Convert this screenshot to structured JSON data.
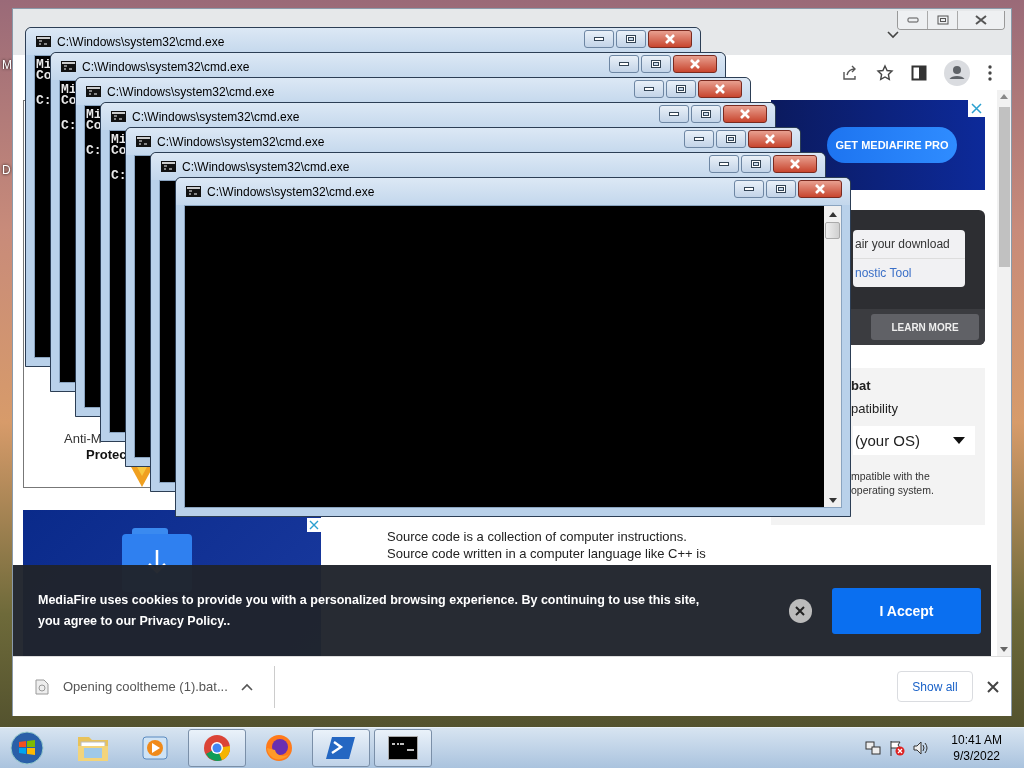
{
  "desktop": {
    "icon_labels": [
      {
        "label": "M"
      },
      {
        "label": "D"
      }
    ]
  },
  "browser": {
    "page": {
      "left_ad": {
        "lines": [
          "Anti-M",
          "Protec"
        ]
      },
      "description": [
        "Source code is a collection of computer instructions.",
        "Source code written in a computer language like C++ is"
      ],
      "top_banner": {
        "button": "GET MEDIAFIRE PRO"
      },
      "repair_card": {
        "line": "air your download",
        "link": "nostic Tool",
        "button": "LEARN MORE"
      },
      "compat_panel": {
        "title": "bat",
        "subtitle": "patibility",
        "select": "(your OS)",
        "note": [
          "mpatible with the",
          "operating system."
        ]
      }
    },
    "cookie_banner": {
      "text": "MediaFire uses cookies to provide you with a personalized browsing experience. By continuing to use this site, you agree to our Privacy Policy..",
      "accept": "I Accept"
    },
    "download_bar": {
      "file": "Opening cooltheme (1).bat...",
      "show_all": "Show all"
    }
  },
  "cmd_windows": [
    {
      "title": "C:\\Windows\\system32\\cmd.exe",
      "lines": [
        "Mi",
        "Co",
        "C:"
      ]
    },
    {
      "title": "C:\\Windows\\system32\\cmd.exe",
      "lines": [
        "Mi",
        "Co",
        "C:"
      ]
    },
    {
      "title": "C:\\Windows\\system32\\cmd.exe",
      "lines": [
        "Mi",
        "Co",
        "C:"
      ]
    },
    {
      "title": "C:\\Windows\\system32\\cmd.exe",
      "lines": [
        "Mi",
        "Co",
        "C:"
      ]
    },
    {
      "title": "C:\\Windows\\system32\\cmd.exe"
    },
    {
      "title": "C:\\Windows\\system32\\cmd.exe"
    },
    {
      "title": "C:\\Windows\\system32\\cmd.exe"
    }
  ],
  "taskbar": {
    "apps": [
      {
        "kind": "explorer",
        "running": false
      },
      {
        "kind": "media",
        "running": false
      },
      {
        "kind": "chrome",
        "running": true
      },
      {
        "kind": "firefox",
        "running": false
      },
      {
        "kind": "powershell",
        "running": true
      },
      {
        "kind": "cmd",
        "running": true
      }
    ],
    "time": "10:41 AM",
    "date": "9/3/2022"
  }
}
